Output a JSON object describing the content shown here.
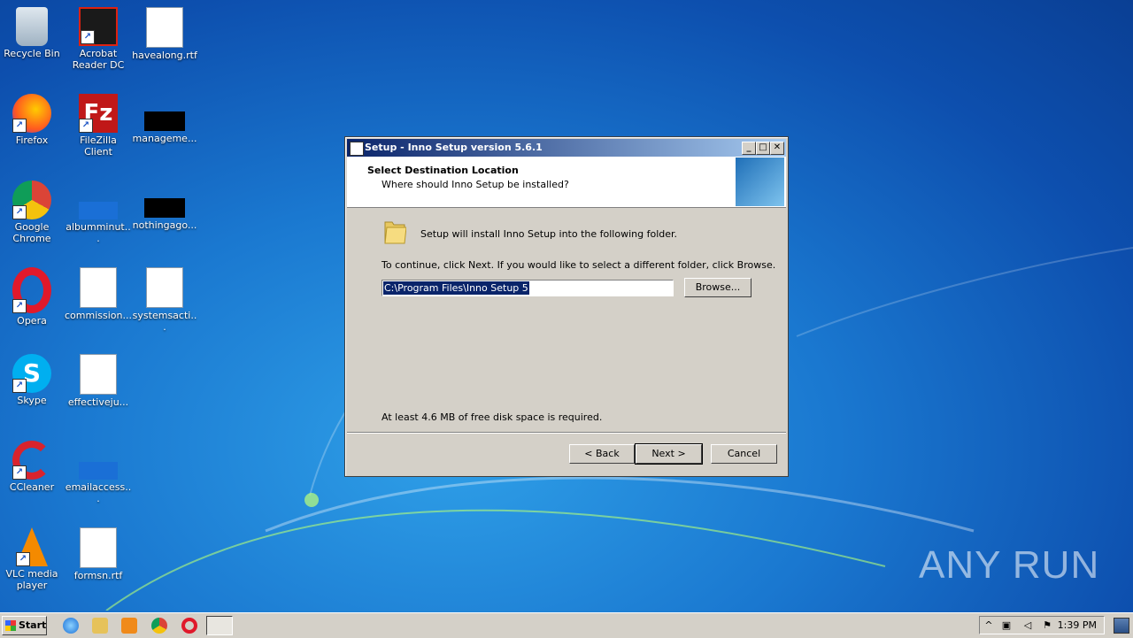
{
  "desktop": {
    "icons": [
      {
        "label": "Recycle Bin"
      },
      {
        "label": "Acrobat Reader DC"
      },
      {
        "label": "havealong.rtf"
      },
      {
        "label": "Firefox"
      },
      {
        "label": "FileZilla Client"
      },
      {
        "label": "manageme..."
      },
      {
        "label": "Google Chrome"
      },
      {
        "label": "albumminut..."
      },
      {
        "label": "nothingago..."
      },
      {
        "label": "Opera"
      },
      {
        "label": "commission..."
      },
      {
        "label": "systemsacti..."
      },
      {
        "label": "Skype"
      },
      {
        "label": "effectiveju..."
      },
      {
        "label": "CCleaner"
      },
      {
        "label": "emailaccess..."
      },
      {
        "label": "VLC media player"
      },
      {
        "label": "formsn.rtf"
      }
    ]
  },
  "dialog": {
    "title": "Setup - Inno Setup version 5.6.1",
    "header_title": "Select Destination Location",
    "header_subtitle": "Where should Inno Setup be installed?",
    "install_text": "Setup will install Inno Setup into the following folder.",
    "continue_text": "To continue, click Next. If you would like to select a different folder, click Browse.",
    "path_value": "C:\\Program Files\\Inno Setup 5",
    "browse_label": "Browse...",
    "disk_space_text": "At least 4.6 MB of free disk space is required.",
    "back_label": "< Back",
    "next_label": "Next >",
    "cancel_label": "Cancel"
  },
  "taskbar": {
    "start_label": "Start",
    "time": "1:39 PM"
  },
  "watermark": "ANY RUN",
  "colors": {
    "titlebar_start": "#0a246a",
    "titlebar_end": "#a6caf0",
    "dialog_bg": "#d4d0c8"
  }
}
